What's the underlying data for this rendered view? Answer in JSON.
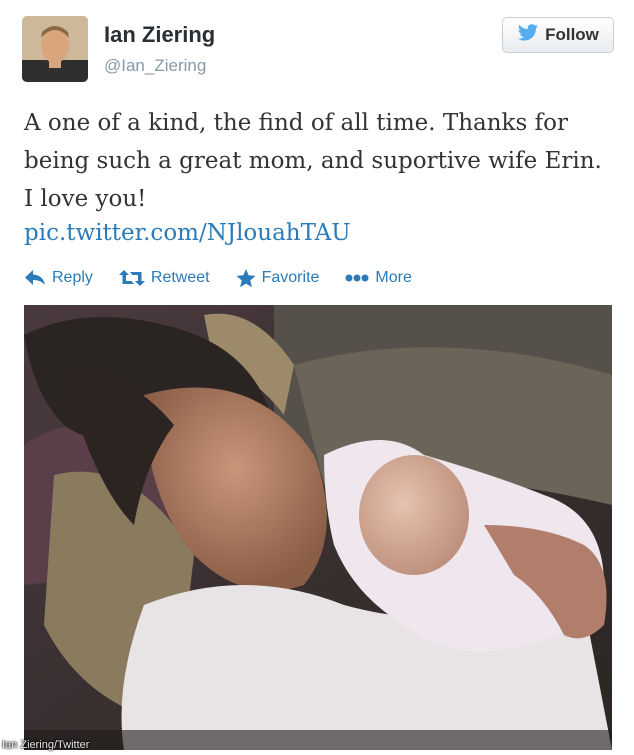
{
  "user": {
    "display_name": "Ian Ziering",
    "screen_name": "@Ian_Ziering"
  },
  "follow_button": {
    "label": "Follow",
    "icon": "twitter-bird-icon"
  },
  "tweet": {
    "text": "A one of a kind, the find of all time. Thanks for being such a great mom, and suportive wife Erin. I love you!",
    "link": "pic.twitter.com/NJlouahTAU"
  },
  "actions": [
    {
      "label": "Reply",
      "icon": "reply-icon"
    },
    {
      "label": "Retweet",
      "icon": "retweet-icon"
    },
    {
      "label": "Favorite",
      "icon": "star-icon"
    },
    {
      "label": "More",
      "icon": "more-dots-icon"
    }
  ],
  "photo": {
    "credit": "Ian Ziering/Twitter"
  },
  "colors": {
    "link": "#2b7bb9",
    "text": "#333333",
    "muted": "#8899a6",
    "bird": "#55acee"
  }
}
